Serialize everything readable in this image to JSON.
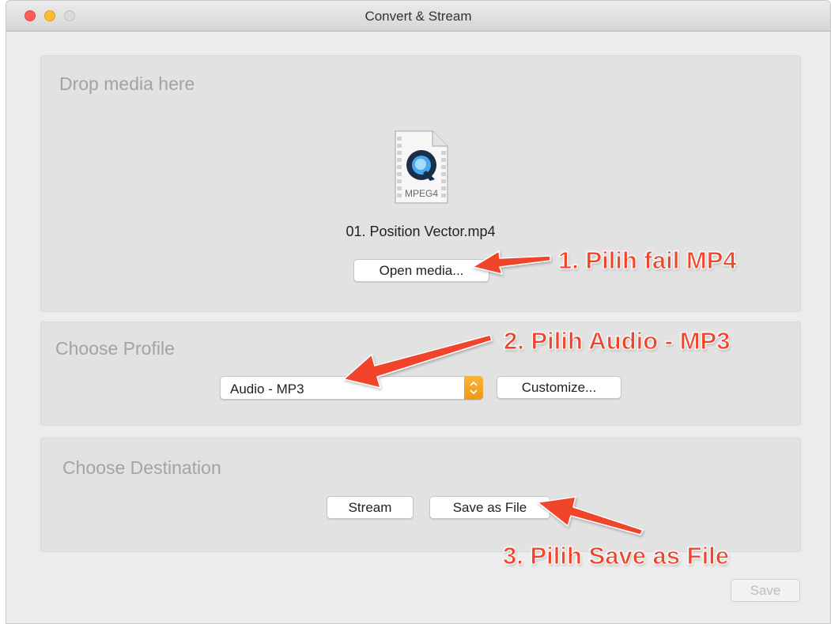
{
  "window": {
    "title": "Convert & Stream"
  },
  "drop_panel": {
    "label": "Drop media here",
    "file_icon_text": "MPEG4",
    "file_name": "01. Position Vector.mp4",
    "open_button": "Open media..."
  },
  "profile_panel": {
    "label": "Choose Profile",
    "selected_profile": "Audio - MP3",
    "customize_button": "Customize..."
  },
  "destination_panel": {
    "label": "Choose Destination",
    "stream_button": "Stream",
    "save_as_file_button": "Save as File"
  },
  "footer": {
    "save_button": "Save"
  },
  "annotations": {
    "step1": "1. Pilih fail MP4",
    "step2": "2. Pilih Audio - MP3",
    "step3": "3. Pilih Save as File"
  },
  "colors": {
    "annotation": "#f0452a",
    "stepper": "#f2a523"
  }
}
